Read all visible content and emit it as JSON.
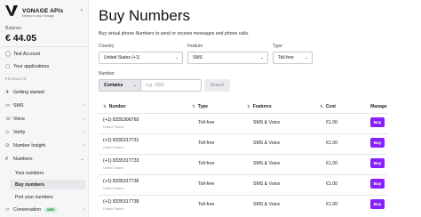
{
  "brand": {
    "name": "VONAGE APIs",
    "subtitle": "Nexmo is now Vonage"
  },
  "balance": {
    "label": "Balance",
    "value": "€ 44.05"
  },
  "sidebar": {
    "account_items": [
      {
        "label": "Test Account",
        "icon": "circle-info-icon"
      },
      {
        "label": "Your applications",
        "icon": "apps-icon"
      }
    ],
    "section_products": "PRODUCTS",
    "product_items": [
      {
        "label": "Getting started",
        "icon": "rocket-icon"
      },
      {
        "label": "SMS",
        "icon": "message-icon"
      },
      {
        "label": "Voice",
        "icon": "phone-icon"
      },
      {
        "label": "Verify",
        "icon": "shield-icon"
      },
      {
        "label": "Number Insight",
        "icon": "number-insight-icon"
      },
      {
        "label": "Numbers",
        "icon": "hash-icon"
      }
    ],
    "numbers_subitems": [
      {
        "label": "Your numbers"
      },
      {
        "label": "Buy numbers"
      },
      {
        "label": "Port your numbers"
      }
    ],
    "conversation": {
      "label": "Conversation",
      "badge": "NEW"
    }
  },
  "main": {
    "title": "Buy Numbers",
    "description": "Buy virtual phone Numbers to send or receive messages and phone calls.",
    "filters": {
      "country": {
        "label": "Country",
        "value": "United States (+1)"
      },
      "feature": {
        "label": "Feature",
        "value": "SMS"
      },
      "type": {
        "label": "Type",
        "value": "Toll-free"
      },
      "number": {
        "label": "Number",
        "mode": "Contains",
        "placeholder": "e.g. 1555"
      },
      "search_label": "Search"
    },
    "table": {
      "headers": {
        "number": "Number",
        "type": "Type",
        "features": "Features",
        "cost": "Cost",
        "manage": "Manage"
      },
      "rows": [
        {
          "number": "(+1) 8335306765",
          "country": "United States",
          "type": "Toll-free",
          "features": "SMS & Voice",
          "cost": "€1.00",
          "action": "Buy"
        },
        {
          "number": "(+1) 8335317731",
          "country": "United States",
          "type": "Toll-free",
          "features": "SMS & Voice",
          "cost": "€1.00",
          "action": "Buy"
        },
        {
          "number": "(+1) 8335317733",
          "country": "United States",
          "type": "Toll-free",
          "features": "SMS & Voice",
          "cost": "€1.00",
          "action": "Buy"
        },
        {
          "number": "(+1) 8335317736",
          "country": "United States",
          "type": "Toll-free",
          "features": "SMS & Voice",
          "cost": "€1.00",
          "action": "Buy"
        },
        {
          "number": "(+1) 8335317738",
          "country": "United States",
          "type": "Toll-free",
          "features": "SMS & Voice",
          "cost": "€1.00",
          "action": "Buy"
        }
      ]
    }
  },
  "colors": {
    "accent": "#871fff",
    "sidebar_bg": "#f6f6f7"
  }
}
